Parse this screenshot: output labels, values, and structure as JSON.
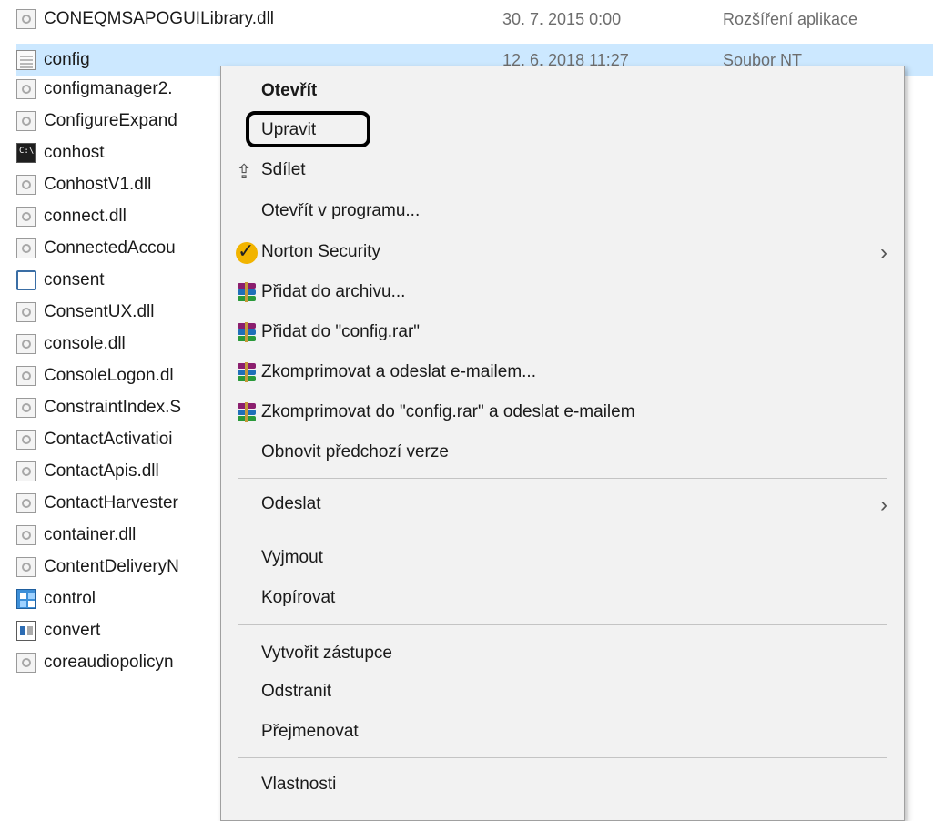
{
  "files": [
    {
      "name": "CONEQMSAPOGUILibrary.dll",
      "date": "30. 7. 2015 0:00",
      "type": "Rozšíření aplikace",
      "icon": "dll-icon"
    },
    {
      "name": "config",
      "date": "12. 6. 2018 11:27",
      "type": "Soubor NT",
      "icon": "text-file-icon",
      "selected": true
    },
    {
      "name": "configmanager2.",
      "icon": "dll-icon"
    },
    {
      "name": "ConfigureExpand",
      "icon": "dll-icon"
    },
    {
      "name": "conhost",
      "icon": "cmd-icon"
    },
    {
      "name": "ConhostV1.dll",
      "icon": "dll-icon"
    },
    {
      "name": "connect.dll",
      "icon": "dll-icon"
    },
    {
      "name": "ConnectedAccou",
      "icon": "dll-icon"
    },
    {
      "name": "consent",
      "icon": "window-icon"
    },
    {
      "name": "ConsentUX.dll",
      "icon": "dll-icon"
    },
    {
      "name": "console.dll",
      "icon": "dll-icon"
    },
    {
      "name": "ConsoleLogon.dl",
      "icon": "dll-icon"
    },
    {
      "name": "ConstraintIndex.S",
      "icon": "dll-icon"
    },
    {
      "name": "ContactActivatioi",
      "icon": "dll-icon"
    },
    {
      "name": "ContactApis.dll",
      "icon": "dll-icon"
    },
    {
      "name": "ContactHarvester",
      "icon": "dll-icon"
    },
    {
      "name": "container.dll",
      "icon": "dll-icon"
    },
    {
      "name": "ContentDeliveryN",
      "icon": "dll-icon"
    },
    {
      "name": "control",
      "icon": "control-panel-icon"
    },
    {
      "name": "convert",
      "icon": "convert-icon"
    },
    {
      "name": "coreaudiopolicyn",
      "icon": "dll-icon"
    }
  ],
  "menu": {
    "open": "Otevřít",
    "edit": "Upravit",
    "share": "Sdílet",
    "open_with": "Otevřít v programu...",
    "norton": "Norton Security",
    "add_archive": "Přidat do archivu...",
    "add_rar": "Přidat do \"config.rar\"",
    "compress_email": "Zkomprimovat a odeslat e-mailem...",
    "compress_rar_email": "Zkomprimovat do \"config.rar\" a odeslat e-mailem",
    "restore_versions": "Obnovit předchozí verze",
    "send_to": "Odeslat",
    "cut": "Vyjmout",
    "copy": "Kopírovat",
    "create_shortcut": "Vytvořit zástupce",
    "delete": "Odstranit",
    "rename": "Přejmenovat",
    "properties": "Vlastnosti"
  },
  "colors": {
    "selection": "#cce8ff",
    "menu_background": "#f2f2f2",
    "highlight_outline": "#000000"
  }
}
